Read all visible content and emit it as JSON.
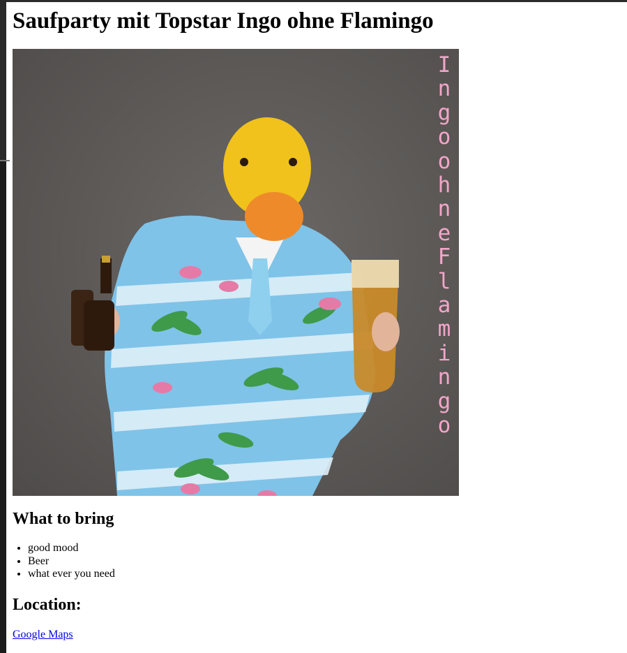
{
  "page": {
    "title": "Saufparty mit Topstar Ingo ohne Flamingo"
  },
  "poster": {
    "overlay_text": "Ingo ohne Flamingo",
    "description_icon": "duck-mask-flamingo-suit-photo",
    "colors": {
      "background": "#5b5856",
      "overlay_text": "#f2a6c8",
      "suit": "#7fc3e8",
      "mask": "#f1c21b"
    }
  },
  "bring": {
    "heading": "What to bring",
    "items": [
      "good mood",
      "Beer",
      "what ever you need"
    ]
  },
  "location": {
    "heading": "Location:",
    "link_label": "Google Maps"
  }
}
